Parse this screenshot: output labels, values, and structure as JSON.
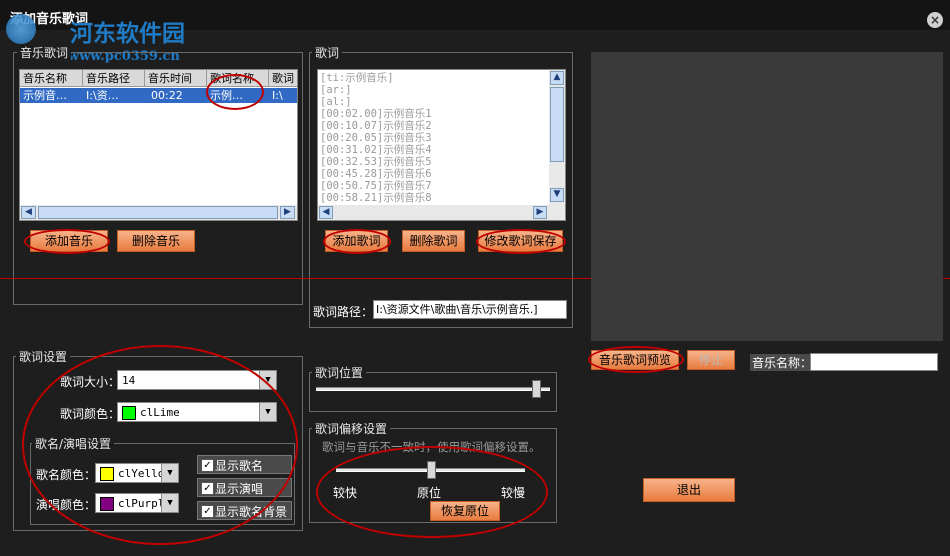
{
  "window": {
    "title": "添加音乐歌词",
    "close_icon": "close-icon"
  },
  "watermark": {
    "name": "河东软件园",
    "url": "www.pc0359.cn"
  },
  "music_list": {
    "label": "音乐歌词",
    "columns": [
      "音乐名称",
      "音乐路径",
      "音乐时间",
      "歌词名称",
      "歌词"
    ],
    "rows": [
      [
        "示例音…",
        "I:\\资…",
        "00:22",
        "示例…",
        "I:\\"
      ]
    ],
    "add_button": "添加音乐",
    "delete_button": "删除音乐"
  },
  "lyrics": {
    "label": "歌词",
    "lines": [
      "[ti:示例音乐]",
      "[ar:]",
      "[al:]",
      "[00:02.00]示例音乐1",
      "[00:10.07]示例音乐2",
      "[00:20.05]示例音乐3",
      "[00:31.02]示例音乐4",
      "[00:32.53]示例音乐5",
      "[00:45.28]示例音乐6",
      "[00:50.75]示例音乐7",
      "[00:58.21]示例音乐8"
    ],
    "add_button": "添加歌词",
    "delete_button": "删除歌词",
    "save_button": "修改歌词保存",
    "path_label": "歌词路径：",
    "path_value": "I:\\资源文件\\歌曲\\音乐\\示例音乐.]"
  },
  "lyric_settings": {
    "label": "歌词设置",
    "size_label": "歌词大小：",
    "size_value": "14",
    "color_label": "歌词颜色：",
    "color_value": "clLime",
    "color_hex": "#00ff00",
    "singer_group_label": "歌名/演唱设置",
    "song_color_label": "歌名颜色：",
    "song_color_value": "clYello",
    "song_color_hex": "#ffff00",
    "singer_color_label": "演唱颜色：",
    "singer_color_value": "clPurpl",
    "singer_color_hex": "#800080",
    "show_song": "显示歌名",
    "show_singer": "显示演唱",
    "show_song_bg": "显示歌名背景"
  },
  "position": {
    "label": "歌词位置",
    "value": 0.94
  },
  "offset": {
    "label": "歌词偏移设置",
    "hint": "歌词与音乐不一致时，使用歌词偏移设置。",
    "fast": "较快",
    "origin": "原位",
    "slow": "较慢",
    "value": 0.5,
    "reset_button": "恢复原位"
  },
  "preview": {
    "preview_button": "音乐歌词预览",
    "stop_button": "停止",
    "name_label": "音乐名称：",
    "name_value": ""
  },
  "exit_button": "退出"
}
